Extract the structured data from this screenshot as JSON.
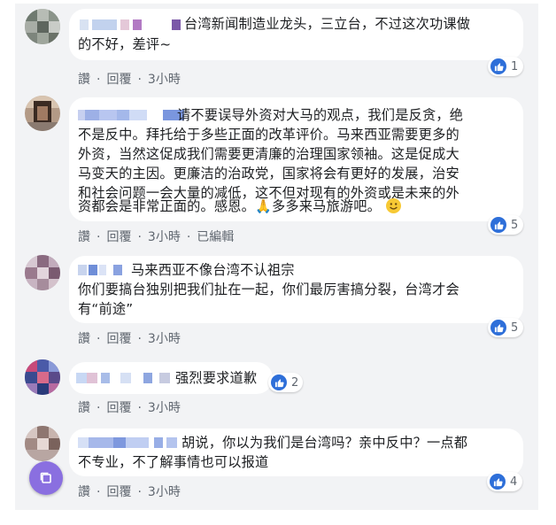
{
  "actions": {
    "like": "讚",
    "reply": "回覆",
    "separator": "·",
    "edited": "已編輯"
  },
  "colors": {
    "background": "#f2f3f5",
    "bubble": "#ffffff",
    "like_blue": "#2e6fd9",
    "action_gray": "#606770",
    "fab_purple": "#8a6fe0"
  },
  "comments": [
    {
      "lines": [
        "台湾新闻制造业龙头，三立台，不过这次功课做",
        "的不好，差评~"
      ],
      "time": "3小時",
      "likes": "1"
    },
    {
      "lines": [
        "请不要误导外资对大马的观点，我们是反贪，绝",
        "不是反中。拜托给于多些正面的改革评价。马来西亚需要更多的",
        "外资，当然这促成我们需要更清廉的治理国家领袖。这是促成大",
        "马变天的主因。更廉洁的治政党，国家将会有更好的发展，治安",
        "和社会问题一会大量的减低，这不但对现有的外资或是未来的外",
        "资都会是非常正面的。感恩。",
        "多多来马旅游吧。"
      ],
      "time": "3小時",
      "likes": "5",
      "emoji_icons": [
        "folded-hands-icon",
        "smiley-icon"
      ]
    },
    {
      "lines": [
        "马来西亚不像台湾不认祖宗",
        "你们要搞台独别把我们扯在一起，你们最厉害搞分裂，台湾才会",
        "有“前途”"
      ],
      "time": "3小時",
      "likes": "5"
    },
    {
      "lines": [
        "强烈要求道歉"
      ],
      "time": "3小時",
      "likes": "2"
    },
    {
      "lines": [
        "胡说，你以为我们是台湾吗？亲中反中？一点都",
        "不专业，不了解事情也可以报道"
      ],
      "time": "3小時",
      "likes": "4"
    }
  ]
}
